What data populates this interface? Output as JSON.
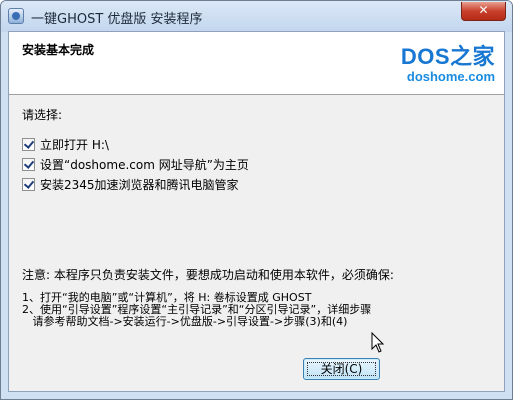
{
  "window": {
    "title": "一键GHOST 优盘版 安装程序",
    "close_label": "✕"
  },
  "header": {
    "title": "安装基本完成",
    "logo_main": "DOS之家",
    "logo_sub": "doshome.com"
  },
  "prompt": "请选择:",
  "options": [
    {
      "label": "立即打开 H:\\",
      "checked": true
    },
    {
      "label": "设置“doshome.com 网址导航”为主页",
      "checked": true
    },
    {
      "label": "安装2345加速浏览器和腾讯电脑管家",
      "checked": true
    }
  ],
  "notice": "注意: 本程序只负责安装文件，要想成功启动和使用本软件，必须确保:",
  "instructions": [
    "1、打开“我的电脑”或“计算机”，将 H: 卷标设置成 GHOST",
    "2、使用“引导设置”程序设置“主引导记录”和“分区引导记录”，详细步骤",
    "   请参考帮助文档->安装运行->优盘版->引导设置->步骤(3)和(4)"
  ],
  "buttons": {
    "close": "关闭(C)"
  }
}
